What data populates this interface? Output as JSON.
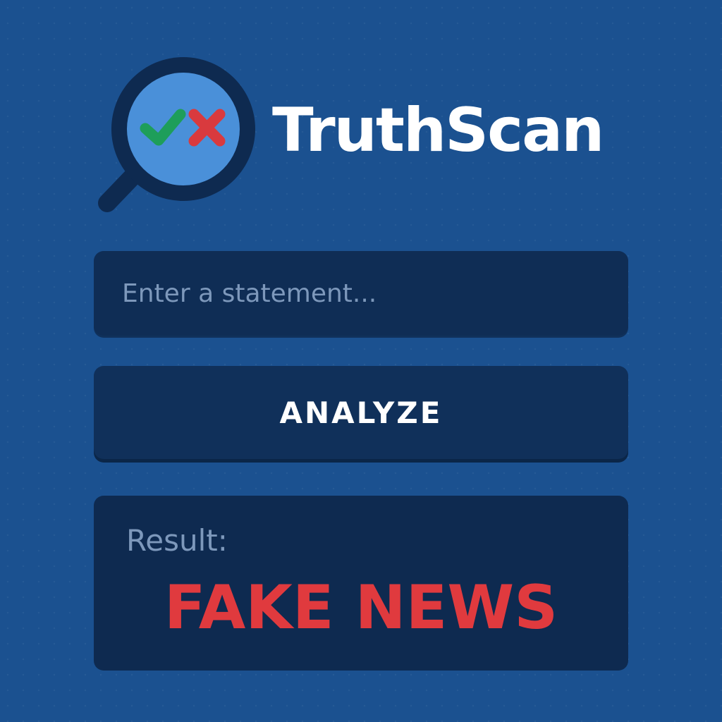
{
  "brand": {
    "name": "TruthScan",
    "icon": "magnifier-check-cross-icon"
  },
  "input": {
    "placeholder": "Enter a statement...",
    "value": ""
  },
  "analyze": {
    "label": "ANALYZE"
  },
  "result": {
    "label": "Result:",
    "value": "FAKE NEWS"
  },
  "colors": {
    "background": "#1b5190",
    "panel": "#0f2d55",
    "lens": "#4a90d9",
    "check": "#1e9e5a",
    "cross": "#d93a3e",
    "result_text": "#e03a3e",
    "label_text": "#7d98bb"
  }
}
